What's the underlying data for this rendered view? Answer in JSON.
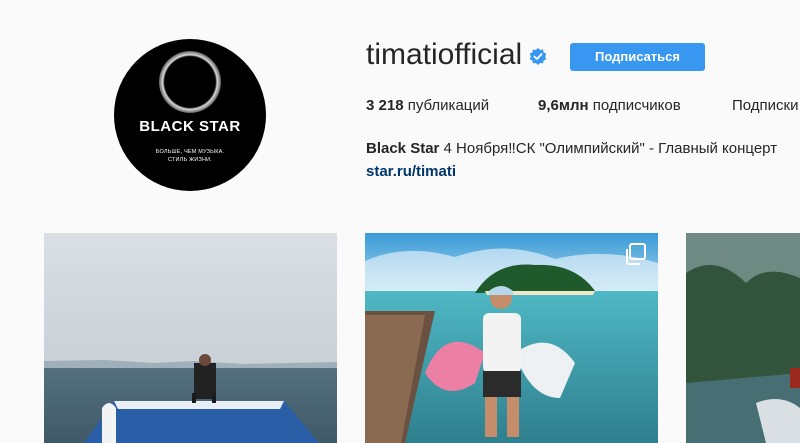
{
  "profile": {
    "username": "timatiofficial",
    "follow_label": "Подписаться",
    "avatar": {
      "brand": "BLACK STAR",
      "tagline_line1": "БОЛЬШЕ, ЧЕМ МУЗЫКА.",
      "tagline_line2": "СТИЛЬ ЖИЗНИ."
    },
    "stats": {
      "posts_count": "3 218",
      "posts_label": "публикаций",
      "followers_count": "9,6млн",
      "followers_label": "подписчиков",
      "following_label": "Подписки"
    },
    "bio": {
      "name": "Black Star",
      "text": "4 Ноября‼СК \"Олимпийский\" - Главный концерт",
      "link": "star.ru/timati"
    }
  },
  "icons": {
    "verified": "verified-badge-icon",
    "carousel": "multiple-photos-icon"
  },
  "colors": {
    "follow_button": "#3897f0",
    "link": "#003569",
    "verified": "#3897f0"
  }
}
